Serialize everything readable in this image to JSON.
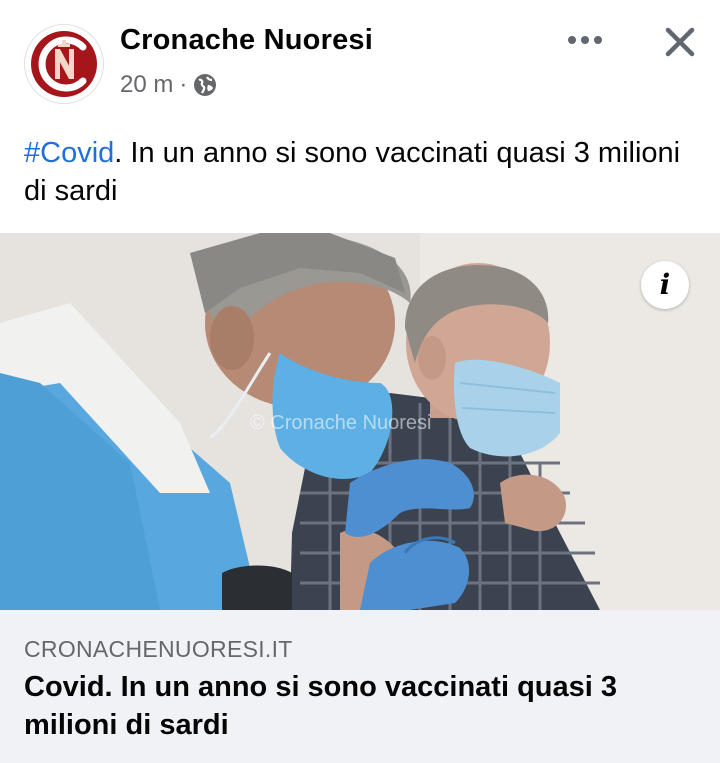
{
  "post": {
    "page_name": "Cronache Nuoresi",
    "timestamp": "20 m",
    "separator": "·",
    "privacy_icon": "globe-icon",
    "more_icon": "more-horizontal-icon",
    "close_icon": "close-icon",
    "caption": {
      "hashtag": "#Covid",
      "text": ". In un anno si sono vaccinati quasi  3 milioni di sardi"
    },
    "image": {
      "description_icon": "info-icon",
      "watermark": "© Cronache Nuoresi"
    },
    "link_preview": {
      "domain": "CRONACHENUORESI.IT",
      "title": "Covid. In un anno si sono vaccinati quasi 3 milioni di sardi"
    }
  },
  "colors": {
    "hashtag": "#216fdb",
    "logo_red": "#a4161a",
    "link_card_bg": "#f0f2f5",
    "meta_text": "#65676b",
    "scrub_blue": "#5aa9df"
  }
}
